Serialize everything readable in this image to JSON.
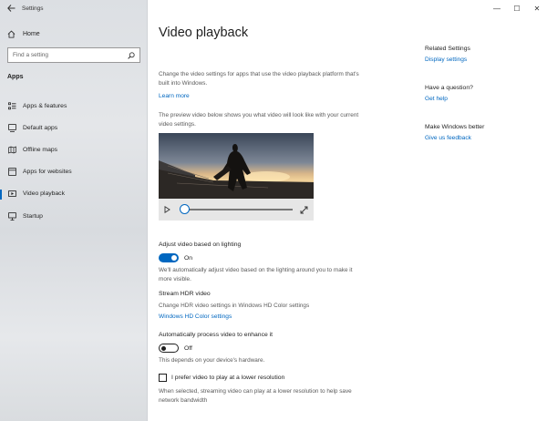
{
  "window": {
    "app_title": "Settings",
    "controls": {
      "minimize": "—",
      "maximize": "☐",
      "close": "✕"
    }
  },
  "sidebar": {
    "home_label": "Home",
    "search_placeholder": "Find a setting",
    "section": "Apps",
    "items": [
      {
        "label": "Apps & features",
        "icon": "apps-list-icon"
      },
      {
        "label": "Default apps",
        "icon": "default-apps-icon"
      },
      {
        "label": "Offline maps",
        "icon": "map-icon"
      },
      {
        "label": "Apps for websites",
        "icon": "web-apps-icon"
      },
      {
        "label": "Video playback",
        "icon": "video-icon",
        "active": true
      },
      {
        "label": "Startup",
        "icon": "startup-icon"
      }
    ]
  },
  "main": {
    "title": "Video playback",
    "intro": "Change the video settings for apps that use the video playback platform that's built into Windows.",
    "learn_more": "Learn more",
    "preview_text": "The preview video below shows you what video will look like with your current video settings.",
    "adjust": {
      "title": "Adjust video based on lighting",
      "state": "On",
      "desc": "We'll automatically adjust video based on the lighting around you to make it more visible."
    },
    "hdr": {
      "title": "Stream HDR video",
      "desc": "Change HDR video settings in Windows HD Color settings",
      "link": "Windows HD Color settings"
    },
    "enhance": {
      "title": "Automatically process video to enhance it",
      "state": "Off",
      "desc": "This depends on your device's hardware."
    },
    "lower_res": {
      "label": "I prefer video to play at a lower resolution",
      "desc": "When selected, streaming video can play at a lower resolution to help save network bandwidth"
    }
  },
  "related": {
    "h1": "Related Settings",
    "l1": "Display settings",
    "h2": "Have a question?",
    "l2": "Get help",
    "h3": "Make Windows better",
    "l3": "Give us feedback"
  },
  "colors": {
    "accent": "#0067c0",
    "sidebar_bg": "#dcdfe3"
  }
}
